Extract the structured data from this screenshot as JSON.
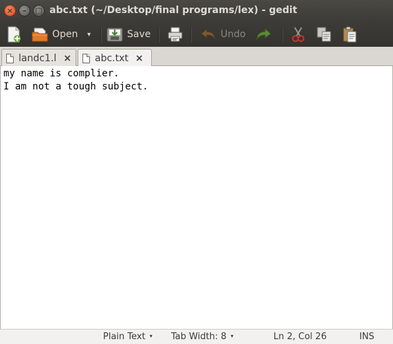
{
  "window": {
    "title": "abc.txt (~/Desktop/final programs/lex) - gedit",
    "close_glyph": "×",
    "min_glyph": "–",
    "max_glyph": "□"
  },
  "toolbar": {
    "open_label": "Open",
    "save_label": "Save",
    "undo_label": "Undo",
    "dropdown_glyph": "▾"
  },
  "tabs": [
    {
      "label": "landc1.l",
      "close": "×",
      "active": false
    },
    {
      "label": "abc.txt",
      "close": "×",
      "active": true
    }
  ],
  "editor": {
    "lines": [
      "my name is complier.",
      "I am not a tough subject."
    ]
  },
  "statusbar": {
    "language": "Plain Text",
    "tab_width": "Tab Width: 8",
    "position": "Ln 2, Col 26",
    "mode": "INS",
    "dropdown_glyph": "▾"
  },
  "colors": {
    "titlebar": "#3c3b37",
    "close_button": "#e04a17",
    "tab_active": "#f2f1f0",
    "editor_background": "#ffffff"
  },
  "icons": [
    "new-document-icon",
    "open-folder-icon",
    "save-icon",
    "print-icon",
    "undo-icon",
    "redo-icon",
    "cut-icon",
    "copy-icon",
    "paste-icon",
    "file-icon"
  ]
}
